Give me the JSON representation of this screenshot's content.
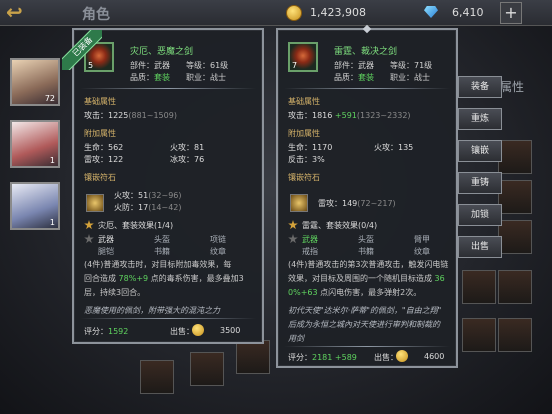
{
  "top": {
    "title": "角色",
    "gold": "1,423,908",
    "gems": "6,410",
    "plus": "+"
  },
  "roster": [
    {
      "level": "72"
    },
    {
      "level": "1"
    },
    {
      "level": "1"
    }
  ],
  "side_buttons": [
    "装备",
    "重炼",
    "镶嵌",
    "重铸",
    "加锁",
    "出售"
  ],
  "bg_tab": "属性",
  "left": {
    "equipped_tag": "已装备",
    "name": "灾厄、恶魔之剑",
    "icon_number": "5",
    "part_label": "部件：",
    "part": "武器",
    "level_label": "等级：",
    "level": "61级",
    "quality_label": "品质：",
    "quality": "套装",
    "class_label": "职业：",
    "class": "战士",
    "base_title": "基础属性",
    "attack": "攻击：1225",
    "attack_range": "(881~1509)",
    "extra_title": "附加属性",
    "extra": [
      {
        "label": "生命：",
        "value": "562"
      },
      {
        "label": "火攻：",
        "value": "81"
      },
      {
        "label": "雷攻：",
        "value": "122"
      },
      {
        "label": "冰攻：",
        "value": "76"
      }
    ],
    "rune_title": "镶嵌符石",
    "rune1_label": "火攻：",
    "rune1_value": "51",
    "rune1_range": "(32~96)",
    "rune2_label": "火防：",
    "rune2_value": "17",
    "rune2_range": "(14~42)",
    "set_title": "灾厄、套装效果(1/4)",
    "set_items": [
      [
        "武器",
        "头盔",
        "项链"
      ],
      [
        "腿铠",
        "书籍",
        "纹章"
      ]
    ],
    "set_effect_a": "(4件)普通攻击时，对目标附加毒效果，每",
    "set_effect_b_pre": "回合造成 ",
    "set_effect_b_green": "78%+9",
    "set_effect_b_post": " 点的毒系伤害，最多叠加3",
    "set_effect_c": "层，持续3回合。",
    "lore": "恶魔使用的佩剑，附带强大的混沌之力",
    "score_label": "评分：",
    "score": "1592",
    "sell_label": "出售：",
    "sell_price": "3500"
  },
  "right": {
    "name": "雷霆、裁决之剑",
    "icon_number": "7",
    "part_label": "部件：",
    "part": "武器",
    "level_label": "等级：",
    "level": "71级",
    "quality_label": "品质：",
    "quality": "套装",
    "class_label": "职业：",
    "class": "战士",
    "base_title": "基础属性",
    "attack": "攻击：1816",
    "attack_bonus": "+591",
    "attack_range": "(1323~2332)",
    "extra_title": "附加属性",
    "extra": [
      {
        "label": "生命：",
        "value": "1170"
      },
      {
        "label": "火攻：",
        "value": "135"
      },
      {
        "label": "反击：",
        "value": "3%"
      }
    ],
    "rune_title": "镶嵌符石",
    "rune1_label": "雷攻：",
    "rune1_value": "149",
    "rune1_range": "(72~217)",
    "set_title": "雷霆、套装效果(0/4)",
    "set_items": [
      [
        "武器",
        "头盔",
        "臂甲"
      ],
      [
        "戒指",
        "书籍",
        "纹章"
      ]
    ],
    "set_effect_a": "(4件)普通攻击的第3次普通攻击，触发闪电链",
    "set_effect_b": "效果，对目标及周围的一个随机目标造成 ",
    "set_effect_b_green": "36",
    "set_effect_c_green": "0%+63",
    "set_effect_c_post": " 点闪电伤害，最多弹射2次。",
    "lore_a": "初代天使\"达米尔·萨蒂\"的佩剑，\"自由之翔\"",
    "lore_b": "后成为永恒之城內对天使进行审判和制裁的",
    "lore_c": "用剑",
    "score_label": "评分：",
    "score": "2181",
    "score_bonus": "+589",
    "sell_label": "出售：",
    "sell_price": "4600"
  }
}
